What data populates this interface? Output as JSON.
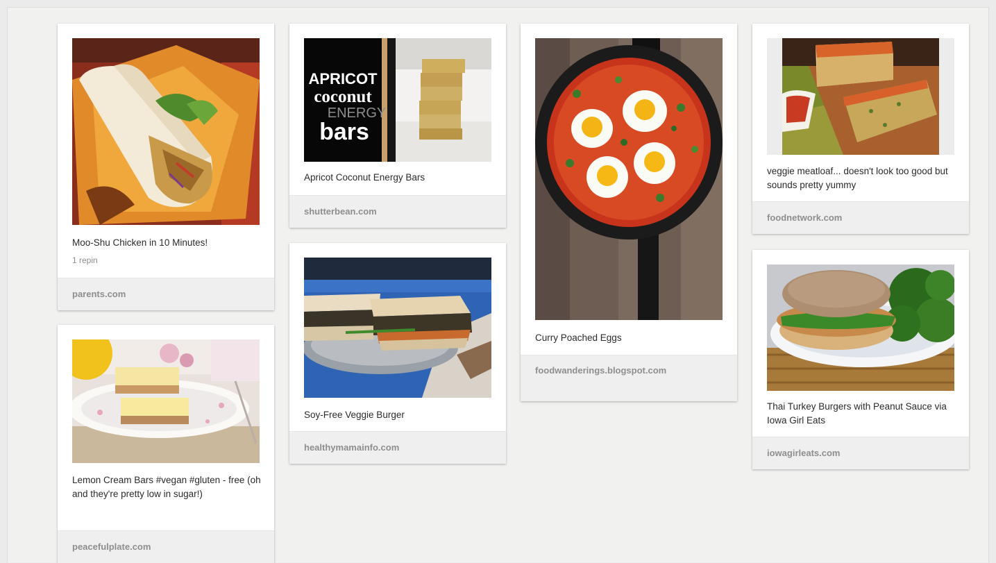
{
  "pins": [
    {
      "id": "moo-shu",
      "description": "Moo-Shu Chicken in 10 Minutes!",
      "repins": "1 repin",
      "source": "parents.com",
      "image_icon": "chicken-wrap-photo"
    },
    {
      "id": "lemon-bars",
      "description": "Lemon Cream Bars #vegan #gluten - free (oh and they're pretty low in sugar!)",
      "source": "peacefulplate.com",
      "image_icon": "lemon-bars-photo"
    },
    {
      "id": "apricot",
      "description": "Apricot Coconut Energy Bars",
      "source": "shutterbean.com",
      "image_icon": "energy-bars-photo",
      "image_text": {
        "line1": "APRICOT",
        "line2": "coconut",
        "line3": "ENERGY",
        "line4": "bars"
      }
    },
    {
      "id": "veggie-burger",
      "description": "Soy-Free Veggie Burger",
      "source": "healthymamainfo.com",
      "image_icon": "veggie-burger-photo"
    },
    {
      "id": "curry-eggs",
      "description": "Curry Poached Eggs",
      "source": "foodwanderings.blogspot.com",
      "image_icon": "poached-eggs-skillet-photo"
    },
    {
      "id": "meatloaf",
      "description": "veggie meatloaf... doesn't look too good but sounds pretty yummy",
      "source": "foodnetwork.com",
      "image_icon": "veggie-meatloaf-photo"
    },
    {
      "id": "turkey-burger",
      "description": "Thai Turkey Burgers with Peanut Sauce via Iowa Girl Eats",
      "source": "iowagirleats.com",
      "image_icon": "turkey-burger-photo"
    }
  ]
}
